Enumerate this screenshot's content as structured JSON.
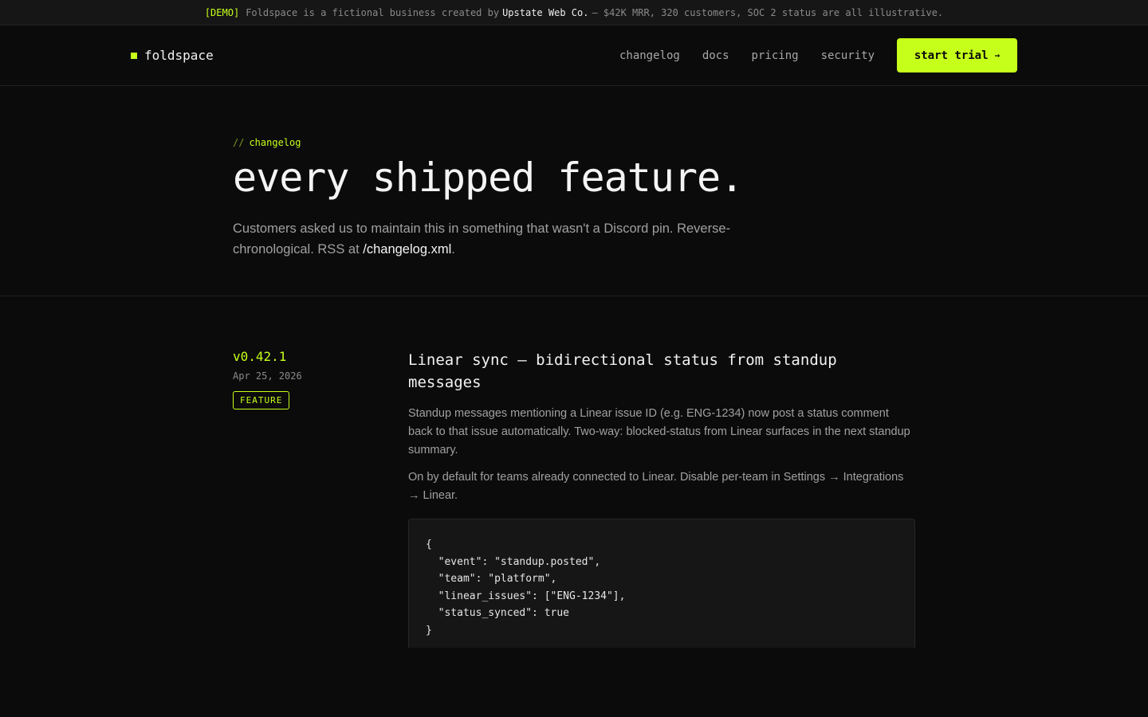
{
  "banner": {
    "tag": "[DEMO]",
    "text_before": "Foldspace is a fictional business created by",
    "brand": "Upstate Web Co.",
    "text_after": "— $42K MRR, 320 customers, SOC 2 status are all illustrative."
  },
  "header": {
    "logo": "foldspace",
    "nav": [
      "changelog",
      "docs",
      "pricing",
      "security"
    ],
    "cta_label": "start trial",
    "cta_arrow": "→"
  },
  "hero": {
    "eyebrow_slashes": "//",
    "eyebrow": "changelog",
    "title": "every shipped feature.",
    "lede_text": "Customers asked us to maintain this in something that wasn't a Discord pin. Reverse-chronological. RSS at ",
    "lede_link": "/changelog.xml",
    "lede_end": "."
  },
  "entry": {
    "version": "v0.42.1",
    "date": "Apr 25, 2026",
    "badge": "FEATURE",
    "title": "Linear sync — bidirectional status from standup messages",
    "paragraphs": [
      "Standup messages mentioning a Linear issue ID (e.g. ENG-1234) now post a status comment back to that issue automatically. Two-way: blocked-status from Linear surfaces in the next standup summary.",
      "On by default for teams already connected to Linear. Disable per-team in Settings → Integrations → Linear."
    ],
    "code": "{\n  \"event\": \"standup.posted\",\n  \"team\": \"platform\",\n  \"linear_issues\": [\"ENG-1234\"],\n  \"status_synced\": true\n}"
  },
  "colors": {
    "accent": "#c6ff1a",
    "background": "#0b0b0b"
  }
}
